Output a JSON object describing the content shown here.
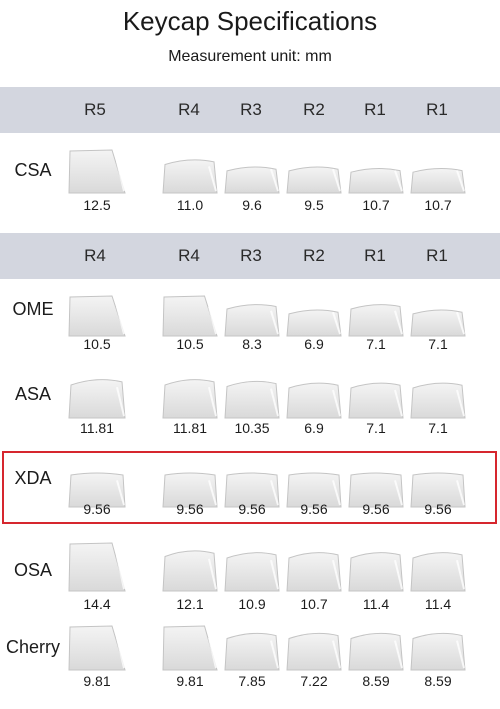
{
  "title": "Keycap Specifications",
  "subtitle": "Measurement unit: mm",
  "headers": {
    "top": [
      "R5",
      "R4",
      "R3",
      "R2",
      "R1",
      "R1"
    ],
    "bottom": [
      "R4",
      "R4",
      "R3",
      "R2",
      "R1",
      "R1"
    ]
  },
  "profiles": [
    {
      "name": "CSA",
      "values": [
        "12.5",
        "11.0",
        "9.6",
        "9.5",
        "10.7",
        "10.7"
      ]
    },
    {
      "name": "OME",
      "values": [
        "10.5",
        "10.5",
        "8.3",
        "6.9",
        "7.1",
        "7.1"
      ]
    },
    {
      "name": "ASA",
      "values": [
        "11.81",
        "11.81",
        "10.35",
        "6.9",
        "7.1",
        "7.1"
      ]
    },
    {
      "name": "XDA",
      "values": [
        "9.56",
        "9.56",
        "9.56",
        "9.56",
        "9.56",
        "9.56"
      ]
    },
    {
      "name": "OSA",
      "values": [
        "14.4",
        "12.1",
        "10.9",
        "10.7",
        "11.4",
        "11.4"
      ]
    },
    {
      "name": "Cherry",
      "values": [
        "9.81",
        "9.81",
        "7.85",
        "7.22",
        "8.59",
        "8.59"
      ]
    }
  ],
  "highlight_color": "#d6262e",
  "header_band_color": "#d3d6df"
}
